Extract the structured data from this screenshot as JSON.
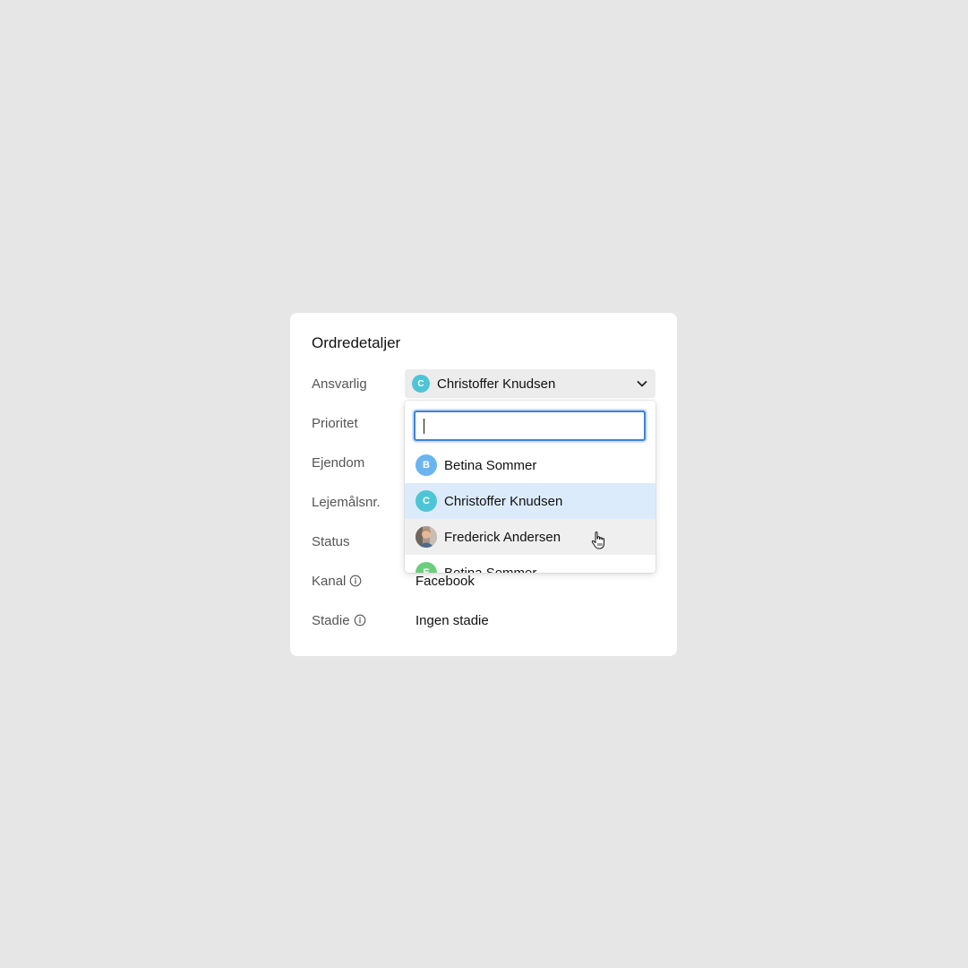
{
  "card": {
    "title": "Ordredetaljer",
    "fields": [
      {
        "label": "Ansvarlig"
      },
      {
        "label": "Prioritet"
      },
      {
        "label": "Ejendom"
      },
      {
        "label": "Lejemålsnr."
      },
      {
        "label": "Status"
      },
      {
        "label": "Kanal",
        "value": "Facebook",
        "info_icon": "info-icon"
      },
      {
        "label": "Stadie",
        "value": "Ingen stadie",
        "info_icon": "info-icon"
      }
    ]
  },
  "select": {
    "value": "Christoffer Knudsen",
    "avatar_letter": "C",
    "avatar_color": "#4ec5d6",
    "icon": "chevron-down-icon"
  },
  "dropdown": {
    "search_value": "",
    "options": [
      {
        "name": "Betina Sommer",
        "avatar_letter": "B",
        "avatar_color": "#6ab4f0",
        "state": "normal"
      },
      {
        "name": "Christoffer Knudsen",
        "avatar_letter": "C",
        "avatar_color": "#4ec5d6",
        "state": "selected"
      },
      {
        "name": "Frederick Andersen",
        "avatar_type": "photo",
        "state": "hover"
      },
      {
        "name": "Betina Sommer",
        "avatar_letter": "E",
        "avatar_color": "#6cce7c",
        "state": "normal"
      }
    ]
  },
  "colors": {
    "background": "#e6e6e6",
    "card": "#ffffff",
    "selected_option": "#dcebfb",
    "hover_option": "#efefef",
    "focus_border": "#3b82d8"
  }
}
